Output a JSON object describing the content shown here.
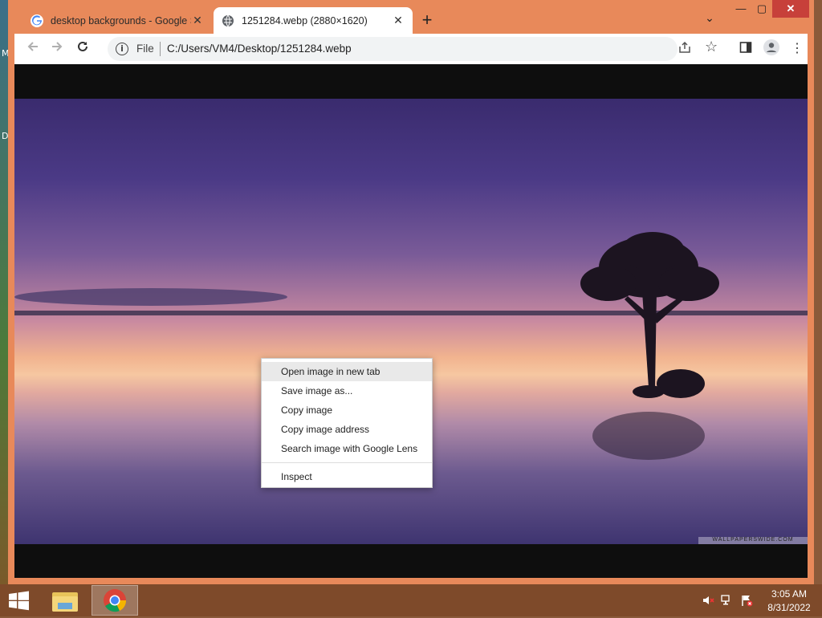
{
  "desktop": {
    "edge_chars": [
      "M",
      "D"
    ]
  },
  "tabs": [
    {
      "title": "desktop backgrounds - Google S",
      "close": "✕",
      "favicon": "google-g-icon",
      "active": false
    },
    {
      "title": "1251284.webp (2880×1620)",
      "close": "✕",
      "favicon": "globe-icon",
      "active": true
    }
  ],
  "titlebar": {
    "new_tab": "+",
    "tab_search": "⌄",
    "minimize": "—",
    "maximize": "▢",
    "close": "✕"
  },
  "toolbar": {
    "scheme_label": "File",
    "url": "C:/Users/VM4/Desktop/1251284.webp"
  },
  "image": {
    "watermark": "WALLPAPERSWIDE.COM"
  },
  "context_menu": {
    "items": [
      "Open image in new tab",
      "Save image as...",
      "Copy image",
      "Copy image address",
      "Search image with Google Lens"
    ],
    "inspect": "Inspect"
  },
  "taskbar": {
    "time": "3:05 AM",
    "date": "8/31/2022"
  },
  "colors": {
    "window_frame": "#e8895a",
    "close_button": "#c7403a",
    "taskbar": "#7e4a2a"
  }
}
